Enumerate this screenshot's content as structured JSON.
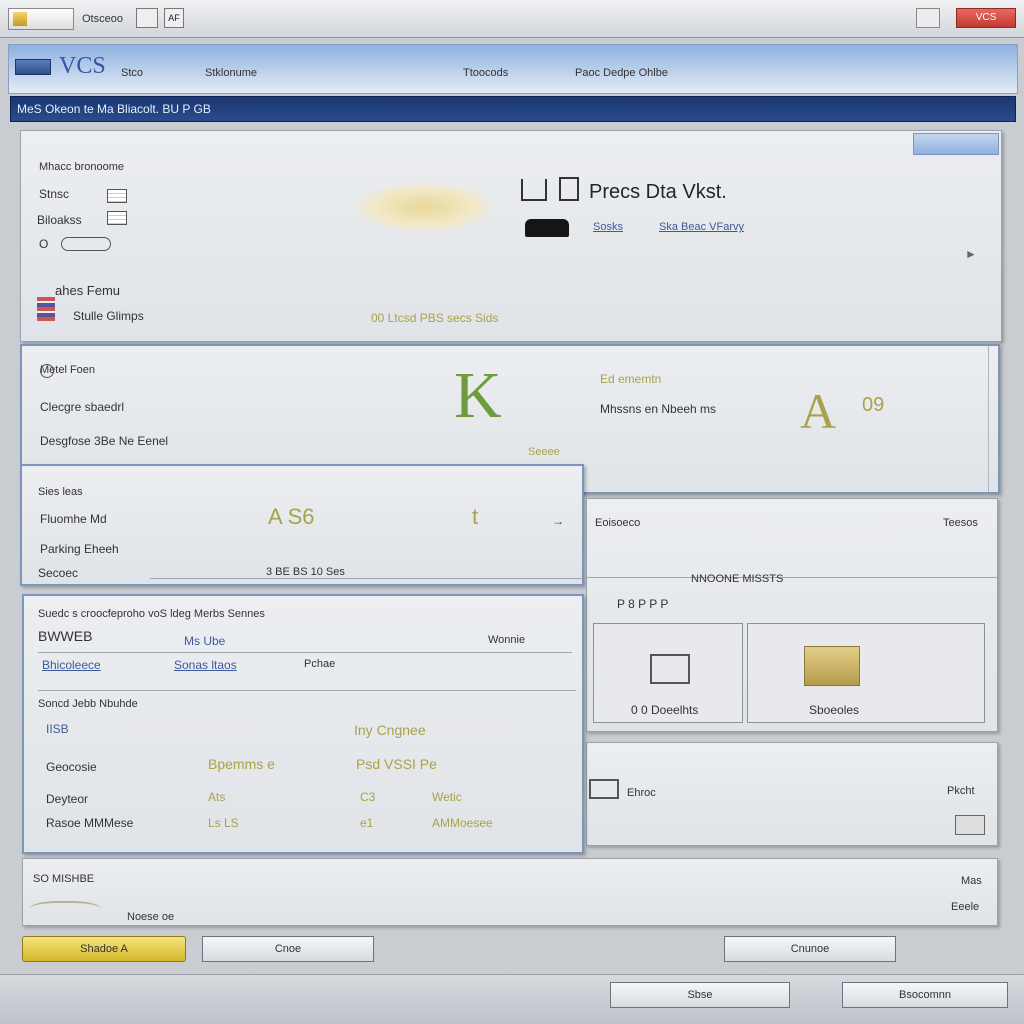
{
  "window": {
    "title": "Otsceoo",
    "close_label": "VCS",
    "toolbar_icon_left": "AF",
    "colors": {
      "title_bar": "#dcdfe3",
      "accent_blue": "#1f3f7a",
      "close_red": "#d0453c",
      "gold": "#d3b72c"
    }
  },
  "menu": {
    "logo": "VCS",
    "items": [
      "Stco",
      "Stklonume",
      "Ttoocods",
      "Paoc Dedpe Ohlbe"
    ]
  },
  "status_strip": {
    "text": "MeS Okeon te Ma Bliacolt. BU P GB"
  },
  "vehicle_panel": {
    "header": "Mhacc bronoome",
    "field1": "Stnsc",
    "field2": "Biloakss",
    "field3": "O",
    "section_label": "ahes Femu",
    "section_value": "Stulle Glimps",
    "title": "Precs Dta Vkst.",
    "link1": "Sosks",
    "link2": "Ska Beac VFarvy",
    "footer": "00 Ltcsd PBS secs Sids"
  },
  "module_panel": {
    "header": "Metel Foen",
    "row1": "Clecgre sbaedrl",
    "row2": "Desgfose 3Be Ne Eenel",
    "letter_k": "K",
    "col_label": "Ed ememtn",
    "col_value": "Mhssns en Nbeeh ms",
    "code": "A",
    "code2": "09",
    "small_code": "Seeee"
  },
  "sensor_panel": {
    "header": "Sies leas",
    "row1": "Fluomhe Md",
    "row2": "Parking Eheeh",
    "row3": "Secoec",
    "value1": "A S6",
    "value2": "t",
    "bottom_row": "3 BE  BS  10  Ses"
  },
  "right_panel": {
    "header_left": "Eoisoeco",
    "header_right": "Teesos",
    "grid_label": "NNOONE MISSTS",
    "row_labels": "P 8  P P  P",
    "box1_label": "0 0 Doeelhts",
    "box2_label": "Sboeoles",
    "footer_left": "Ehroc",
    "footer_right": "Pkcht"
  },
  "diagnostic_panel": {
    "header": "Suedc s croocfeproho voS ldeg Merbs Sennes",
    "field1": "BWWEB",
    "field2": "Ms Ube",
    "field3": "Wonnie",
    "input1": "Bhicoleece",
    "input2": "Sonas ltaos",
    "input3": "Pchae",
    "section": "Soncd Jebb Nbuhde",
    "item1": "IISB",
    "gold1": "Iny  Cngnee",
    "row_a_label": "Geocosie",
    "row_a_value1": "Bpemms  e",
    "row_a_value2": "Psd VSSI  Pe",
    "row_b_label": "Deyteor",
    "row_b_value1": "Ats",
    "row_b_value2": "C3",
    "row_b_value3": "Wetic",
    "row_c_label": "Rasoe MMMese",
    "row_c_value1": "Ls  LS",
    "row_c_value2": "e1",
    "row_c_value3": "AMMoesee"
  },
  "log_panel": {
    "header": "SO MISHBE",
    "sub": "Noese oe",
    "right1": "Mas",
    "right2": "Eeele"
  },
  "buttons": {
    "primary": "Shadoe A",
    "secondary": "Cnoe",
    "third": "Cnunoe",
    "bottom_left": "Sbse",
    "bottom_right": "Bsocomnn"
  }
}
